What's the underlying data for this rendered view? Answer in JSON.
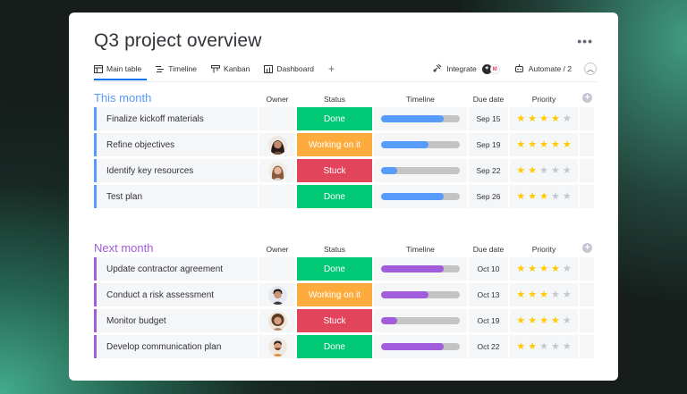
{
  "title": "Q3 project overview",
  "tabs": [
    {
      "label": "Main table",
      "icon": "table-icon"
    },
    {
      "label": "Timeline",
      "icon": "timeline-icon"
    },
    {
      "label": "Kanban",
      "icon": "kanban-icon"
    },
    {
      "label": "Dashboard",
      "icon": "dashboard-icon"
    }
  ],
  "toolbar": {
    "integrate_label": "Integrate",
    "automate_label": "Automate / 2"
  },
  "columns": {
    "owner": "Owner",
    "status": "Status",
    "timeline": "Timeline",
    "due": "Due date",
    "priority": "Priority"
  },
  "colors": {
    "done": "#00c875",
    "working": "#fdab3d",
    "stuck": "#e2445c",
    "this_month": "#579bfc",
    "next_month": "#a25ddc",
    "star_on": "#ffcb00",
    "star_off": "#c5c7d0"
  },
  "groups": [
    {
      "title": "This month",
      "color": "#579bfc",
      "rows": [
        {
          "name": "Finalize kickoff materials",
          "owner": "",
          "status": "Done",
          "status_key": "done",
          "progress": 0.8,
          "due": "Sep 15",
          "stars": 4
        },
        {
          "name": "Refine objectives",
          "owner": "woman-dark-hair",
          "status": "Working on it",
          "status_key": "working",
          "progress": 0.6,
          "due": "Sep 19",
          "stars": 5
        },
        {
          "name": "Identify key resources",
          "owner": "woman-brown-hair",
          "status": "Stuck",
          "status_key": "stuck",
          "progress": 0.2,
          "due": "Sep 22",
          "stars": 2
        },
        {
          "name": "Test plan",
          "owner": "",
          "status": "Done",
          "status_key": "done",
          "progress": 0.8,
          "due": "Sep 26",
          "stars": 3
        }
      ]
    },
    {
      "title": "Next month",
      "color": "#a25ddc",
      "rows": [
        {
          "name": "Update contractor agreement",
          "owner": "",
          "status": "Done",
          "status_key": "done",
          "progress": 0.8,
          "due": "Oct 10",
          "stars": 4
        },
        {
          "name": "Conduct a risk assessment",
          "owner": "man-dark-hair",
          "status": "Working on it",
          "status_key": "working",
          "progress": 0.6,
          "due": "Oct 13",
          "stars": 3
        },
        {
          "name": "Monitor budget",
          "owner": "woman-curly-hair",
          "status": "Stuck",
          "status_key": "stuck",
          "progress": 0.2,
          "due": "Oct 19",
          "stars": 4
        },
        {
          "name": "Develop communication plan",
          "owner": "man-beard",
          "status": "Done",
          "status_key": "done",
          "progress": 0.8,
          "due": "Oct 22",
          "stars": 2
        }
      ]
    }
  ]
}
